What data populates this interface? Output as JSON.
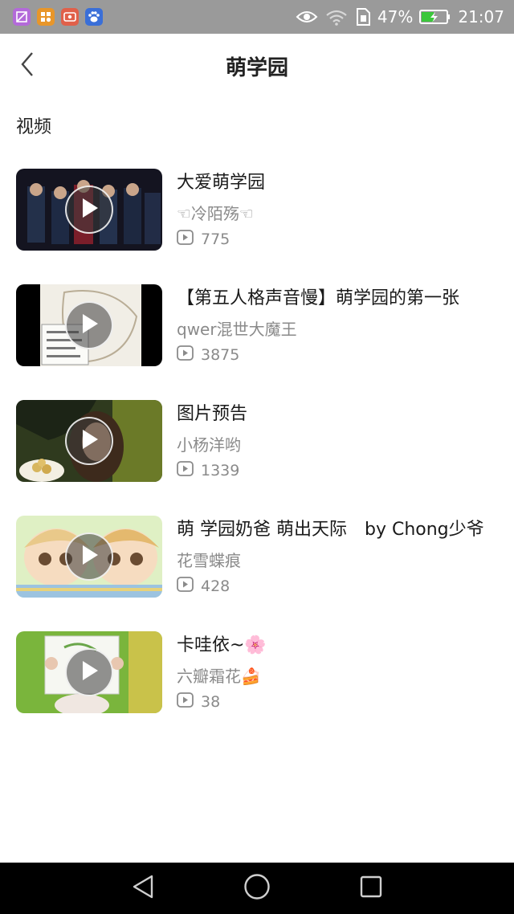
{
  "status_bar": {
    "battery": "47%",
    "time": "21:07",
    "icons": [
      "gallery-app-icon",
      "app-store-icon",
      "video-app-icon",
      "baidu-paw-icon",
      "eye-comfort-icon",
      "wifi-icon",
      "sim-icon",
      "battery-charging-icon"
    ]
  },
  "header": {
    "title": "萌学园",
    "back_icon": "chevron-left-icon"
  },
  "section": {
    "label": "视频"
  },
  "videos": [
    {
      "title": "大爱萌学园",
      "author": "☜冷陌殇☜",
      "plays": "775"
    },
    {
      "title": "【第五人格声音慢】萌学园的第一张",
      "author": "qwer混世大魔王",
      "plays": "3875"
    },
    {
      "title": "图片预告",
      "author": "小杨洋哟",
      "plays": "1339"
    },
    {
      "title": "萌 学园奶爸 萌出天际　by Chong少爷",
      "author": "花雪蝶痕",
      "plays": "428"
    },
    {
      "title": "卡哇依~🌸",
      "author": "六瓣霜花🍰",
      "plays": "38"
    }
  ],
  "nav_bar": {
    "icons": [
      "back-triangle-icon",
      "home-circle-icon",
      "recents-square-icon"
    ]
  },
  "colors": {
    "status_bar": "#9a9a9a",
    "nav_bar": "#000000",
    "secondary_text": "#8a8a8a"
  }
}
